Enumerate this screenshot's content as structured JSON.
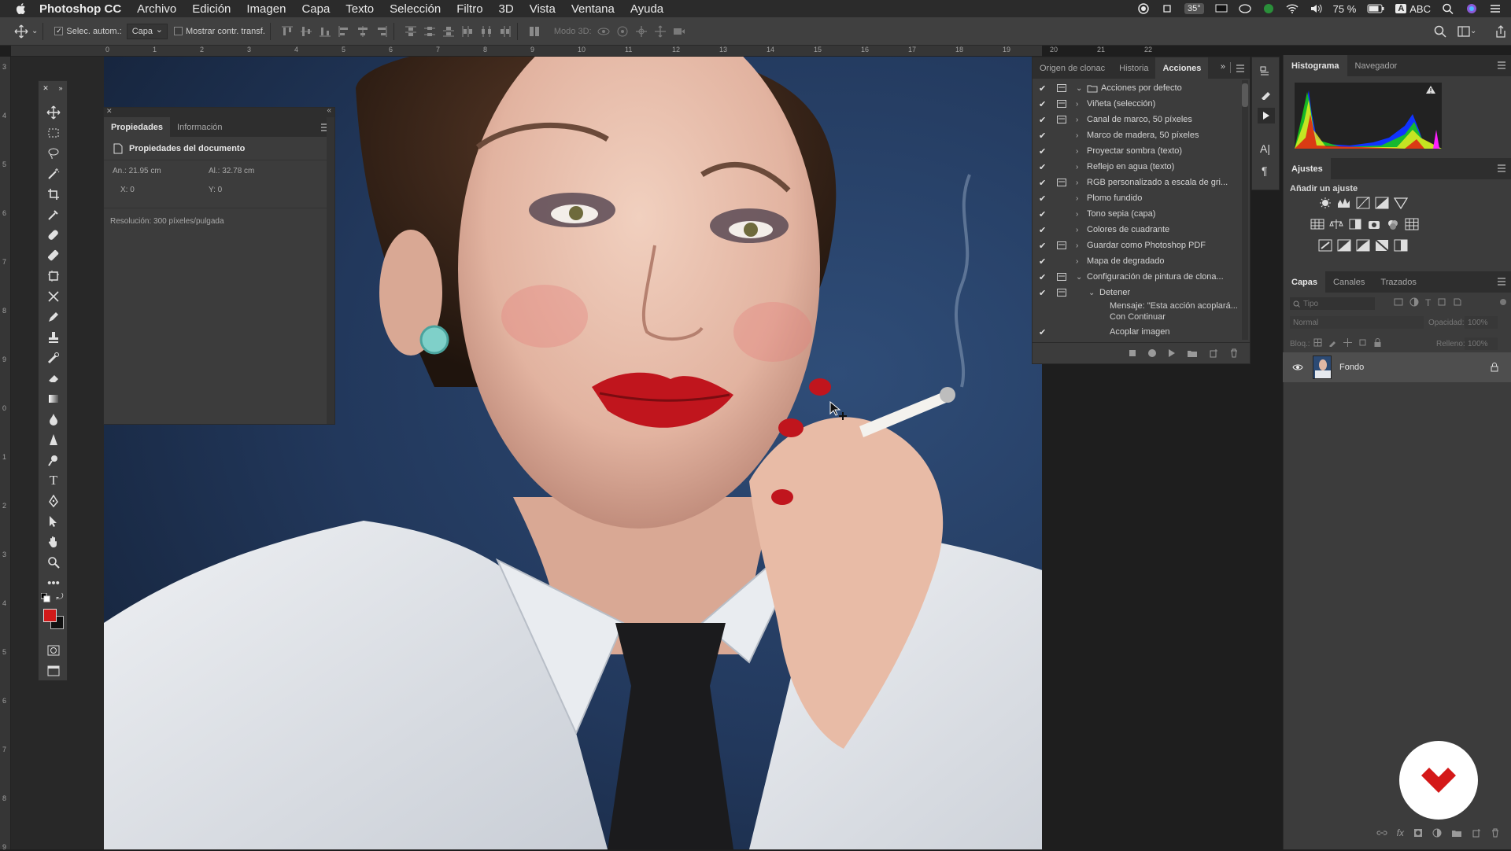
{
  "menubar": {
    "app_name": "Photoshop CC",
    "items": [
      "Archivo",
      "Edición",
      "Imagen",
      "Capa",
      "Texto",
      "Selección",
      "Filtro",
      "3D",
      "Vista",
      "Ventana",
      "Ayuda"
    ],
    "status": {
      "temp": "35°",
      "battery": "75 %",
      "input_source": "ABC"
    }
  },
  "options_bar": {
    "auto_select_label": "Selec. autom.:",
    "auto_select_checked": true,
    "auto_select_value": "Capa",
    "show_transform_label": "Mostrar contr. transf.",
    "mode_3d_label": "Modo 3D:"
  },
  "ruler": {
    "h_ticks": [
      "0",
      "1",
      "2",
      "3",
      "4",
      "5",
      "6",
      "7",
      "8",
      "9",
      "10",
      "11",
      "12",
      "13",
      "14",
      "15",
      "16",
      "17",
      "18",
      "19",
      "20",
      "21",
      "22"
    ],
    "v_ticks": [
      "3",
      "4",
      "5",
      "6",
      "7",
      "8",
      "9",
      "0",
      "1",
      "2",
      "3",
      "4",
      "5",
      "6",
      "7",
      "8",
      "9"
    ]
  },
  "properties_panel": {
    "tabs": [
      "Propiedades",
      "Información"
    ],
    "active_tab": "Propiedades",
    "section_title": "Propiedades del documento",
    "width": "An.: 21.95 cm",
    "height": "Al.: 32.78 cm",
    "x": "X: 0",
    "y": "Y: 0",
    "resolution": "Resolución: 300 píxeles/pulgada"
  },
  "actions_panel": {
    "tabs": [
      "Origen de clonac",
      "Historia",
      "Acciones"
    ],
    "active_tab": "Acciones",
    "rows": [
      {
        "label": "Acciones por defecto",
        "checked": true,
        "dialog": true,
        "level": 0,
        "expanded": true,
        "folder": true
      },
      {
        "label": "Viñeta (selección)",
        "checked": true,
        "dialog": true,
        "level": 1,
        "expanded": false
      },
      {
        "label": "Canal de marco, 50 píxeles",
        "checked": true,
        "dialog": true,
        "level": 1,
        "expanded": false
      },
      {
        "label": "Marco de madera, 50 píxeles",
        "checked": true,
        "dialog": false,
        "level": 1,
        "expanded": false
      },
      {
        "label": "Proyectar sombra (texto)",
        "checked": true,
        "dialog": false,
        "level": 1,
        "expanded": false
      },
      {
        "label": "Reflejo en agua (texto)",
        "checked": true,
        "dialog": false,
        "level": 1,
        "expanded": false
      },
      {
        "label": "RGB personalizado a escala de gri...",
        "checked": true,
        "dialog": true,
        "level": 1,
        "expanded": false
      },
      {
        "label": "Plomo fundido",
        "checked": true,
        "dialog": false,
        "level": 1,
        "expanded": false
      },
      {
        "label": "Tono sepia (capa)",
        "checked": true,
        "dialog": false,
        "level": 1,
        "expanded": false
      },
      {
        "label": "Colores de cuadrante",
        "checked": true,
        "dialog": false,
        "level": 1,
        "expanded": false
      },
      {
        "label": "Guardar como Photoshop PDF",
        "checked": true,
        "dialog": true,
        "level": 1,
        "expanded": false
      },
      {
        "label": "Mapa de degradado",
        "checked": true,
        "dialog": false,
        "level": 1,
        "expanded": false
      },
      {
        "label": "Configuración de pintura de clona...",
        "checked": true,
        "dialog": true,
        "level": 1,
        "expanded": true
      },
      {
        "label": "Detener",
        "checked": true,
        "dialog": true,
        "level": 2,
        "expanded": true
      }
    ],
    "message_line1": "Mensaje:  \"Esta acción acoplará...",
    "message_line2": "Con Continuar",
    "last_row": "Acoplar imagen"
  },
  "histogram_panel": {
    "tabs": [
      "Histograma",
      "Navegador"
    ],
    "active_tab": "Histograma"
  },
  "adjustments_panel": {
    "title": "Ajustes",
    "subtitle": "Añadir un ajuste"
  },
  "layers_panel": {
    "tabs": [
      "Capas",
      "Canales",
      "Trazados"
    ],
    "active_tab": "Capas",
    "search_placeholder": "Tipo",
    "blend_mode": "Normal",
    "opacity_label": "Opacidad:",
    "opacity_value": "100%",
    "lock_label": "Bloq.:",
    "fill_label": "Relleno:",
    "fill_value": "100%",
    "layers": [
      {
        "name": "Fondo",
        "visible": true,
        "locked": true
      }
    ]
  },
  "colors": {
    "foreground": "#d11a1a",
    "background": "#111111",
    "accent_logo": "#d41818"
  }
}
